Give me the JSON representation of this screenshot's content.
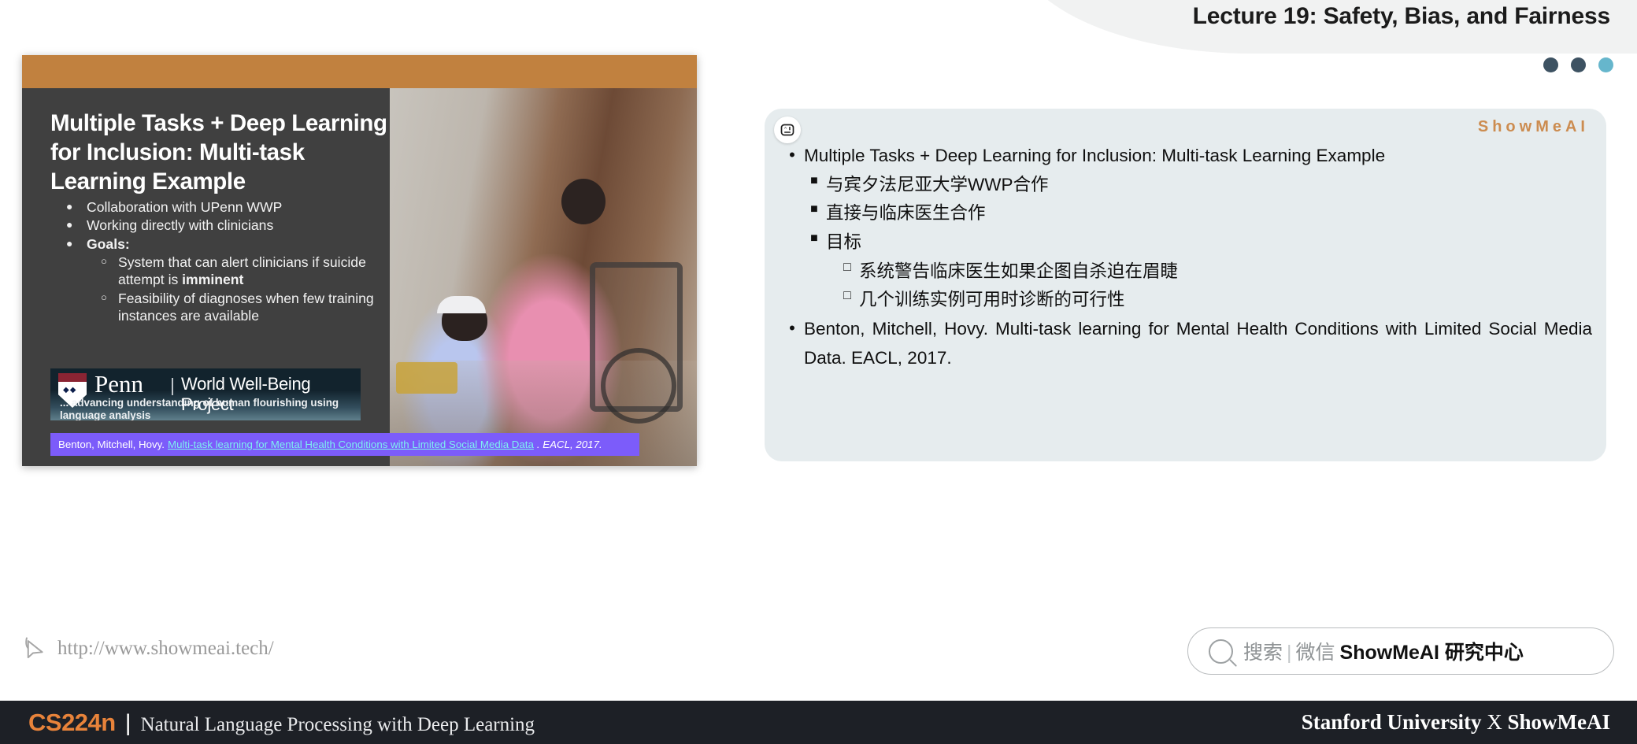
{
  "header": {
    "lecture_title": "Lecture 19: Safety, Bias, and Fairness",
    "dot_colors": [
      "#3d5262",
      "#3d5262",
      "#66b6cc"
    ]
  },
  "slide": {
    "title": "Multiple Tasks + Deep Learning for Inclusion: Multi-task Learning Example",
    "bullets": [
      {
        "level": 1,
        "marker": "●",
        "text": "Collaboration with UPenn WWP",
        "bold": false
      },
      {
        "level": 1,
        "marker": "●",
        "text": "Working directly with clinicians",
        "bold": false
      },
      {
        "level": 1,
        "marker": "●",
        "text": "Goals:",
        "bold": true
      }
    ],
    "subbullets": [
      {
        "level": 2,
        "marker": "○",
        "text_pre": "System that can alert clinicians if suicide attempt is ",
        "text_bold": "imminent",
        "text_post": ""
      },
      {
        "level": 2,
        "marker": "○",
        "text_pre": "Feasibility of diagnoses when few training instances are available",
        "text_bold": "",
        "text_post": ""
      }
    ],
    "penn_logo": {
      "name": "Penn",
      "separator": "|",
      "project": "World Well-Being Project",
      "tagline": "... advancing understanding of human flourishing using language analysis"
    },
    "citation": {
      "authors": "Benton, Mitchell, Hovy.",
      "link": "Multi-task learning for Mental Health Conditions with Limited Social Media Data",
      "venue": ". EACL, 2017."
    }
  },
  "panel": {
    "logo": "ShowMeAI",
    "items": [
      {
        "level": 1,
        "marker": "•",
        "text": "Multiple Tasks + Deep Learning for Inclusion: Multi-task Learning Example"
      },
      {
        "level": 2,
        "marker": "■",
        "text": "与宾夕法尼亚大学WWP合作"
      },
      {
        "level": 2,
        "marker": "■",
        "text": "直接与临床医生合作"
      },
      {
        "level": 2,
        "marker": "■",
        "text": "目标"
      },
      {
        "level": 3,
        "marker": "□",
        "text": "系统警告临床医生如果企图自杀迫在眉睫"
      },
      {
        "level": 3,
        "marker": "□",
        "text": "几个训练实例可用时诊断的可行性"
      },
      {
        "level": 1,
        "marker": "•",
        "text": "Benton, Mitchell, Hovy. Multi-task learning for Mental Health Conditions with Limited Social Media Data. EACL, 2017."
      }
    ]
  },
  "bottom": {
    "url": "http://www.showmeai.tech/",
    "search": {
      "placeholder_cn": "搜索",
      "separator": "|",
      "channel": "微信",
      "brand": "ShowMeAI 研究中心"
    }
  },
  "footer": {
    "course_code": "CS224n",
    "divider": "|",
    "course_name": "Natural Language Processing with Deep Learning",
    "org_left": "Stanford University",
    "org_x": "X",
    "org_right": "ShowMeAI"
  }
}
